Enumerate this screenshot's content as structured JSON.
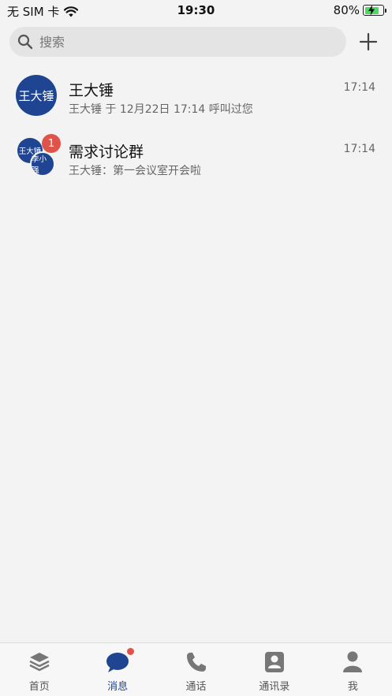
{
  "status_bar": {
    "carrier": "无 SIM 卡",
    "time": "19:30",
    "battery": "80%"
  },
  "search": {
    "placeholder": "搜索"
  },
  "conversations": [
    {
      "name": "王大锤",
      "avatar_text": "王大锤",
      "preview": "王大锤 于 12月22日 17:14 呼叫过您",
      "time": "17:14"
    },
    {
      "name": "需求讨论群",
      "avatar_texts": [
        "王大锤",
        "李小强"
      ],
      "badge": "1",
      "preview": "王大锤：第一会议室开会啦",
      "time": "17:14"
    }
  ],
  "tabs": [
    {
      "label": "首页",
      "icon": "layers-icon"
    },
    {
      "label": "消息",
      "icon": "chat-bubble-icon"
    },
    {
      "label": "通话",
      "icon": "phone-icon"
    },
    {
      "label": "通讯录",
      "icon": "contacts-icon"
    },
    {
      "label": "我",
      "icon": "person-icon"
    }
  ],
  "colors": {
    "accent": "#1f4592",
    "badge": "#e05348",
    "background": "#f3f3f3"
  }
}
